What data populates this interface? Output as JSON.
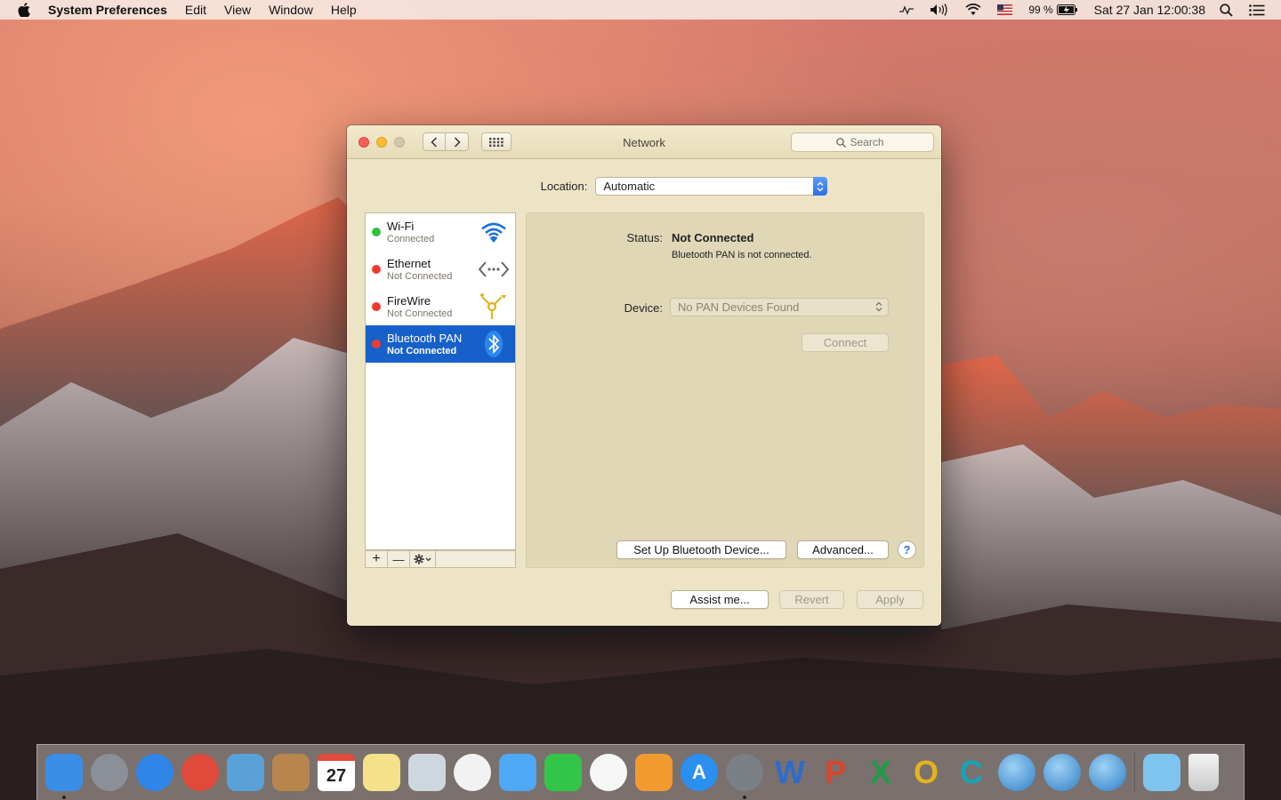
{
  "menubar": {
    "app_name": "System Preferences",
    "menus": [
      "Edit",
      "View",
      "Window",
      "Help"
    ],
    "battery": "99 %",
    "clock": "Sat 27 Jan  12:00:38"
  },
  "window": {
    "title": "Network",
    "search_placeholder": "Search",
    "location_label": "Location:",
    "location_value": "Automatic"
  },
  "services": [
    {
      "name": "Wi-Fi",
      "status": "Connected",
      "state": "green",
      "icon": "wifi-icon"
    },
    {
      "name": "Ethernet",
      "status": "Not Connected",
      "state": "red",
      "icon": "ethernet-icon"
    },
    {
      "name": "FireWire",
      "status": "Not Connected",
      "state": "red",
      "icon": "firewire-icon"
    },
    {
      "name": "Bluetooth PAN",
      "status": "Not Connected",
      "state": "red",
      "icon": "bluetooth-icon",
      "selected": true
    }
  ],
  "list_tools": {
    "add": "+",
    "remove": "—"
  },
  "detail": {
    "status_label": "Status:",
    "status_value": "Not Connected",
    "status_sub": "Bluetooth PAN is not connected.",
    "device_label": "Device:",
    "device_value": "No PAN Devices Found",
    "connect_label": "Connect",
    "setup_label": "Set Up Bluetooth Device...",
    "advanced_label": "Advanced...",
    "help_label": "?"
  },
  "footer": {
    "assist_label": "Assist me...",
    "revert_label": "Revert",
    "apply_label": "Apply"
  },
  "colors": {
    "selection": "#1760c9",
    "window_bg": "#ede4c6",
    "connected": "#2bc13e",
    "disconnected": "#f03a30"
  },
  "dock": [
    {
      "name": "finder-icon",
      "color": "#3a8ee8",
      "glyph": ""
    },
    {
      "name": "launchpad-icon",
      "color": "#8a8f98",
      "glyph": ""
    },
    {
      "name": "safari-icon",
      "color": "#2f86e8",
      "glyph": ""
    },
    {
      "name": "chrome-icon",
      "color": "#e04a3a",
      "glyph": ""
    },
    {
      "name": "mail-icon",
      "color": "#5aa0d8",
      "glyph": ""
    },
    {
      "name": "contacts-icon",
      "color": "#b8864c",
      "glyph": ""
    },
    {
      "name": "calendar-icon",
      "color": "#ffffff",
      "glyph": "27"
    },
    {
      "name": "notes-icon",
      "color": "#f3e28a",
      "glyph": ""
    },
    {
      "name": "preview-icon",
      "color": "#cfd7de",
      "glyph": ""
    },
    {
      "name": "photos-icon",
      "color": "#f2f2f2",
      "glyph": ""
    },
    {
      "name": "messages-icon",
      "color": "#4fa8f5",
      "glyph": ""
    },
    {
      "name": "facetime-icon",
      "color": "#33c548",
      "glyph": ""
    },
    {
      "name": "itunes-icon",
      "color": "#f6f6f6",
      "glyph": ""
    },
    {
      "name": "ibooks-icon",
      "color": "#f29a2e",
      "glyph": ""
    },
    {
      "name": "appstore-icon",
      "color": "#2b8ff0",
      "glyph": "A"
    },
    {
      "name": "system-preferences-icon",
      "color": "#7b7f86",
      "glyph": ""
    },
    {
      "name": "word-icon",
      "color": "transparent",
      "glyph": "W"
    },
    {
      "name": "powerpoint-icon",
      "color": "transparent",
      "glyph": "P"
    },
    {
      "name": "excel-icon",
      "color": "transparent",
      "glyph": "X"
    },
    {
      "name": "outlook-icon",
      "color": "transparent",
      "glyph": "O"
    },
    {
      "name": "teams-icon",
      "color": "transparent",
      "glyph": "C"
    },
    {
      "name": "messenger-icon",
      "color": "transparent",
      "glyph": ""
    },
    {
      "name": "network-globe-icon",
      "color": "transparent",
      "glyph": ""
    },
    {
      "name": "remote-desktop-icon",
      "color": "transparent",
      "glyph": ""
    },
    {
      "name": "downloads-folder-icon",
      "color": "#7dc4ef",
      "glyph": ""
    },
    {
      "name": "trash-icon",
      "color": "transparent",
      "glyph": ""
    }
  ]
}
